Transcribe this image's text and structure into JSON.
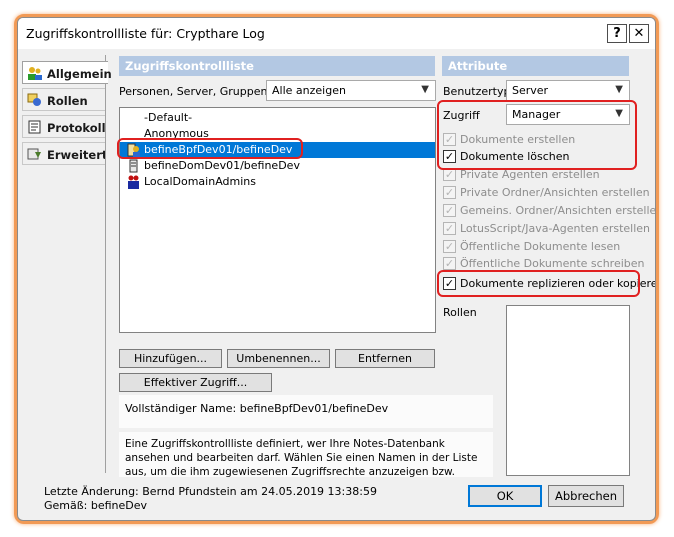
{
  "window": {
    "title": "Zugriffskontrollliste für: Crypthare Log",
    "help_label": "?",
    "close_label": "✕"
  },
  "tabs": [
    {
      "label": "Allgemein",
      "icon": "people-icon",
      "active": true
    },
    {
      "label": "Rollen",
      "icon": "roles-icon",
      "active": false
    },
    {
      "label": "Protokoll",
      "icon": "log-icon",
      "active": false
    },
    {
      "label": "Erweitert",
      "icon": "advanced-icon",
      "active": false
    }
  ],
  "acl": {
    "header": "Zugriffskontrollliste",
    "filter_label": "Personen, Server, Gruppen",
    "filter_value": "Alle anzeigen",
    "entries": [
      {
        "label": "-Default-",
        "icon": "",
        "selected": false
      },
      {
        "label": "Anonymous",
        "icon": "",
        "selected": false
      },
      {
        "label": "befineBpfDev01/befineDev",
        "icon": "server-user-icon",
        "selected": true
      },
      {
        "label": "befineDomDev01/befineDev",
        "icon": "server-icon",
        "selected": false
      },
      {
        "label": "LocalDomainAdmins",
        "icon": "group-icon",
        "selected": false
      }
    ],
    "add_label": "Hinzufügen...",
    "rename_label": "Umbenennen...",
    "remove_label": "Entfernen",
    "effective_label": "Effektiver Zugriff...",
    "full_name": "Vollständiger Name: befineBpfDev01/befineDev",
    "description": "Eine Zugriffskontrollliste definiert, wer Ihre Notes-Datenbank ansehen und bearbeiten darf. Wählen Sie einen Namen in der Liste aus, um die ihm zugewiesenen Zugriffsrechte anzuzeigen bzw. festzulegen."
  },
  "attributes": {
    "header": "Attribute",
    "user_type_label": "Benutzertyp",
    "user_type_value": "Server",
    "access_label": "Zugriff",
    "access_value": "Manager",
    "permissions": [
      {
        "label": "Dokumente erstellen",
        "checked": true,
        "enabled": false
      },
      {
        "label": "Dokumente löschen",
        "checked": true,
        "enabled": true
      },
      {
        "label": "Private Agenten erstellen",
        "checked": true,
        "enabled": false
      },
      {
        "label": "Private Ordner/Ansichten erstellen",
        "checked": true,
        "enabled": false
      },
      {
        "label": "Gemeins. Ordner/Ansichten erstellen",
        "checked": true,
        "enabled": false
      },
      {
        "label": "LotusScript/Java-Agenten erstellen",
        "checked": true,
        "enabled": false
      },
      {
        "label": "Öffentliche Dokumente lesen",
        "checked": true,
        "enabled": false
      },
      {
        "label": "Öffentliche Dokumente schreiben",
        "checked": true,
        "enabled": false
      },
      {
        "label": "Dokumente replizieren oder kopieren",
        "checked": true,
        "enabled": true
      }
    ],
    "roles_label": "Rollen",
    "roles": []
  },
  "footer": {
    "last_change": "Letzte Änderung: Bernd Pfundstein am 24.05.2019 13:38:59",
    "according_to": "Gemäß: befineDev",
    "ok_label": "OK",
    "cancel_label": "Abbrechen"
  },
  "colors": {
    "highlight_annotation": "#e02020",
    "outer_glow": "#f29a55",
    "selection": "#0078d7",
    "section_header": "#b3c8e3"
  }
}
